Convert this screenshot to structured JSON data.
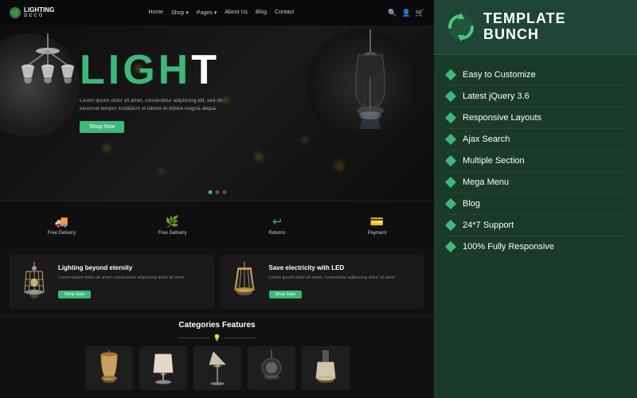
{
  "nav": {
    "logo_top": "LIGHTING",
    "logo_bottom": "DECO",
    "links": [
      "Home",
      "Shop ▾",
      "Pages ▾",
      "About Us",
      "Blog",
      "Contact"
    ]
  },
  "hero": {
    "title_part1": "LIGH",
    "title_part2": "T",
    "subtitle": "Lorem ipsum dolor sit amet, consectetur adipiscing elit, sed do eiusmod tempor incididunt ut labore et dolore magna aliqua.",
    "btn_label": "Shop Now"
  },
  "features_bar": [
    {
      "icon": "🚚",
      "label": "Free Delivery"
    },
    {
      "icon": "🌿",
      "label": "Free Delivery"
    },
    {
      "icon": "↩",
      "label": "Returns"
    },
    {
      "icon": "💳",
      "label": "Payment"
    }
  ],
  "category_cards": [
    {
      "title": "Lighting beyond eternity",
      "text": "Lorem ipsum dolor sit amet, consectetur adipiscing dolor sit amet",
      "btn": "Shop Now"
    },
    {
      "title": "Save electricity with LED",
      "text": "Lorem ipsum dolor sit amet, consectetur adipiscing dolor sit amet",
      "btn": "Shop Now"
    }
  ],
  "categories_section": {
    "title": "Categories Features"
  },
  "brand": {
    "name": "teMplATe BUNCH",
    "name_display": "TEMPLATE\nBUNCH"
  },
  "features": [
    {
      "label": "Easy to Customize"
    },
    {
      "label": "Latest jQuery 3.6"
    },
    {
      "label": "Responsive Layouts"
    },
    {
      "label": "Ajax Search"
    },
    {
      "label": "Multiple Section"
    },
    {
      "label": "Mega Menu"
    },
    {
      "label": "Blog"
    },
    {
      "label": "24*7 Support"
    },
    {
      "label": "100% Fully Responsive"
    }
  ]
}
